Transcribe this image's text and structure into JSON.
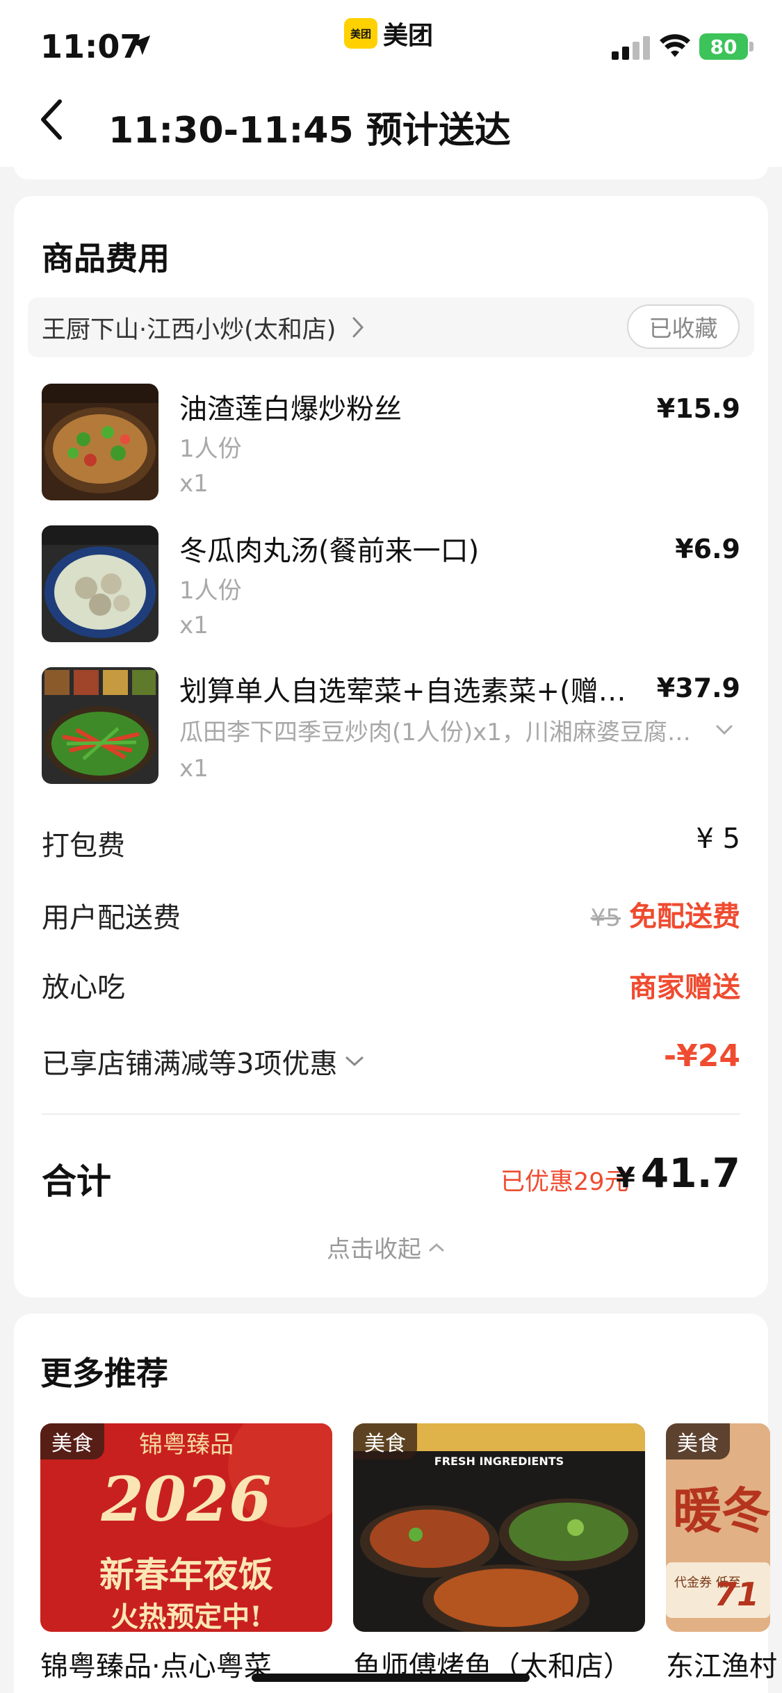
{
  "status_bar": {
    "time": "11:07",
    "battery": "80"
  },
  "app": {
    "name": "美团",
    "logo_text": "美团"
  },
  "nav": {
    "title": "11:30-11:45 预计送达"
  },
  "fees_section": {
    "title": "商品费用",
    "store": {
      "name": "王厨下山·江西小炒(太和店)",
      "favorite_label": "已收藏"
    },
    "items": [
      {
        "name": "油渣莲白爆炒粉丝",
        "sub": "1人份",
        "qty": "x1",
        "price": "¥15.9"
      },
      {
        "name": "冬瓜肉丸汤(餐前来一口)",
        "sub": "1人份",
        "qty": "x1",
        "price": "¥6.9"
      },
      {
        "name": "划算单人自选荤菜+自选素菜+(赠饮…",
        "sub": "瓜田李下四季豆炒肉(1人份)x1，川湘麻婆豆腐…",
        "qty": "x1",
        "price": "¥37.9"
      }
    ],
    "packing": {
      "label": "打包费",
      "value": "¥ 5"
    },
    "delivery": {
      "label": "用户配送费",
      "original": "¥5",
      "value": "免配送费"
    },
    "assurance": {
      "label": "放心吃",
      "value": "商家赠送"
    },
    "discount": {
      "label": "已享店铺满减等3项优惠",
      "value": "-¥24"
    },
    "total": {
      "label": "合计",
      "saved": "已优惠29元",
      "currency": "¥",
      "amount": "41.7"
    },
    "collapse_label": "点击收起"
  },
  "recommend": {
    "title": "更多推荐",
    "items": [
      {
        "badge": "美食",
        "name": "锦粤臻品·点心粤菜"
      },
      {
        "badge": "美食",
        "name": "鱼师傅烤鱼（太和店）"
      },
      {
        "badge": "美食",
        "name": "东江渔村"
      }
    ],
    "images": [
      {
        "brand": "锦粤臻品",
        "year": "2026",
        "line1": "新春年夜饭",
        "line2": "火热预定中!"
      },
      {
        "brand": "FRESH INGREDIENTS"
      },
      {
        "line1": "暖冬",
        "price": "71",
        "tag": "代金券 低至"
      }
    ]
  }
}
